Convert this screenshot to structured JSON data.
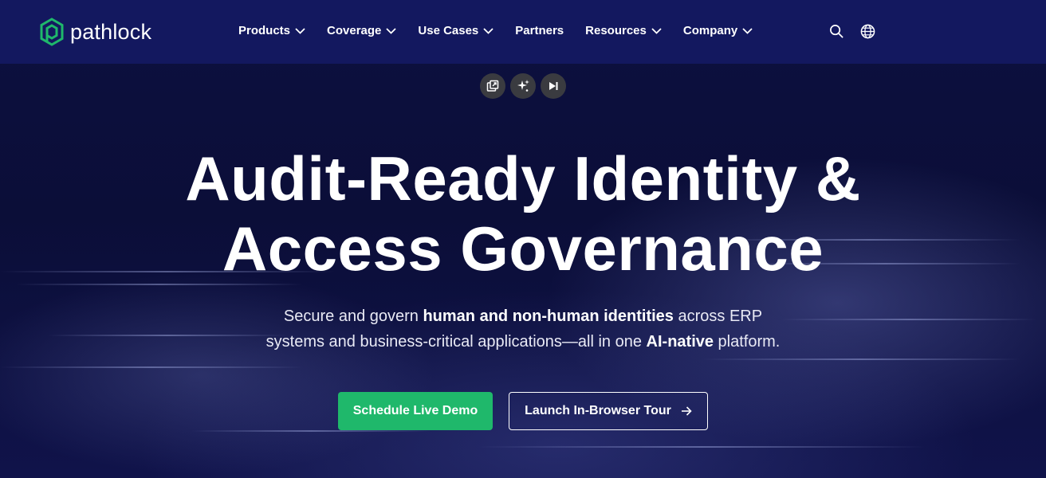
{
  "brand": {
    "name": "pathlock",
    "accent": "#1fb86b"
  },
  "nav": {
    "items": [
      {
        "label": "Products",
        "dropdown": true
      },
      {
        "label": "Coverage",
        "dropdown": true
      },
      {
        "label": "Use Cases",
        "dropdown": true
      },
      {
        "label": "Partners",
        "dropdown": false
      },
      {
        "label": "Resources",
        "dropdown": true
      },
      {
        "label": "Company",
        "dropdown": true
      }
    ],
    "icons": [
      "search-icon",
      "globe-icon"
    ]
  },
  "media_controls": [
    "picture-in-picture-icon",
    "sparkle-icon",
    "skip-forward-icon"
  ],
  "hero": {
    "headline_line1": "Audit-Ready Identity &",
    "headline_line2": "Access Governance",
    "sub_part1": "Secure and govern ",
    "sub_bold1": "human and non-human identities",
    "sub_part2": " across ERP",
    "sub_part3": "systems and business-critical applications—all in one ",
    "sub_bold2": "AI-native",
    "sub_part4": " platform.",
    "cta_primary": "Schedule Live Demo",
    "cta_secondary": "Launch In-Browser Tour"
  },
  "colors": {
    "nav_bg": "#13185f",
    "hero_bg": "#0c0f3d",
    "primary_button": "#1fb86b"
  }
}
